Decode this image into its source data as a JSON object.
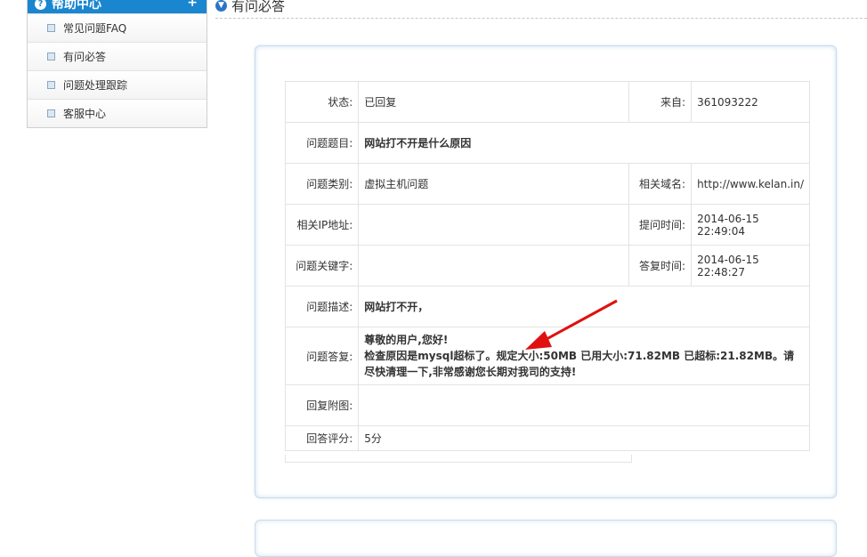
{
  "sidebar": {
    "header": "帮助中心",
    "header_plus": "+",
    "items": [
      {
        "label": "常见问题FAQ"
      },
      {
        "label": "有问必答"
      },
      {
        "label": "问题处理跟踪"
      },
      {
        "label": "客服中心"
      }
    ]
  },
  "page": {
    "title": "有问必答"
  },
  "ticket": {
    "status_label": "状态:",
    "status": "已回复",
    "from_label": "来自:",
    "from": "361093222",
    "subject_label": "问题题目:",
    "subject": "网站打不开是什么原因",
    "category_label": "问题类别:",
    "category": "虚拟主机问题",
    "domain_label": "相关域名:",
    "domain": "http://www.kelan.in/",
    "ip_label": "相关IP地址:",
    "ip": "",
    "asked_time_label": "提问时间:",
    "asked_time": "2014-06-15 22:49:04",
    "keywords_label": "问题关键字:",
    "keywords": "",
    "answered_time_label": "答复时间:",
    "answered_time": "2014-06-15 22:48:27",
    "description_label": "问题描述:",
    "description": "网站打不开，",
    "answer_label": "问题答复:",
    "answer_line1": "尊敬的用户,您好!",
    "answer_line2": "检查原因是mysql超标了。规定大小:50MB 已用大小:71.82MB 已超标:21.82MB。请",
    "answer_line3": "尽快清理一下,非常感谢您长期对我司的支持!",
    "attachment_label": "回复附图:",
    "attachment": "",
    "rating_label": "回答评分:",
    "rating": "5分"
  },
  "colors": {
    "accent": "#1a86d0",
    "answer_red": "#e01010",
    "subject_green": "#2a7a1e",
    "desc_blue": "#1a7ac8"
  }
}
